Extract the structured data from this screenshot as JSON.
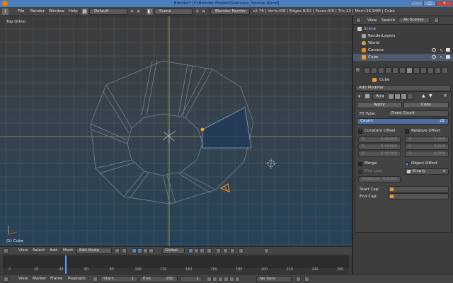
{
  "window": {
    "title": "Blender* [F:\\Blender Models\\Staircase_Tutorial.blend]"
  },
  "info_header": {
    "menus": [
      "File",
      "Render",
      "Window",
      "Help"
    ],
    "layout": "Default",
    "scene": "Scene",
    "engine": "Blender Render",
    "stats": "v2.76 | Verts:0/8 | Edges:0/12 | Faces:0/6 | Tris:12 | Mem:26.94M | Cube"
  },
  "viewport": {
    "view_label": "Top Ortho",
    "object_label": "(1) Cube"
  },
  "view3d_header": {
    "menus": [
      "View",
      "Select",
      "Add",
      "Mesh"
    ],
    "mode": "Edit Mode",
    "orientation": "Global"
  },
  "timeline": {
    "ticks": [
      "0",
      "20",
      "40",
      "60",
      "80",
      "100",
      "120",
      "140",
      "160",
      "180",
      "200",
      "220",
      "240",
      "260"
    ],
    "current_frame_fraction": 0.18
  },
  "timeline_header": {
    "menus": [
      "View",
      "Marker",
      "Frame",
      "Playback"
    ],
    "start_label": "Start:",
    "start": "1",
    "end_label": "End:",
    "end": "250",
    "current": "1",
    "sync": "No Sync"
  },
  "outliner": {
    "menus": [
      "View",
      "Search"
    ],
    "filter": "All Scenes",
    "items": [
      {
        "label": "Scene",
        "icon_color": "#c8c8c8"
      },
      {
        "label": "RenderLayers",
        "icon_color": "#a0a0a0"
      },
      {
        "label": "World",
        "icon_color": "#d9a040"
      },
      {
        "label": "Camera",
        "icon_color": "#d88a2a"
      },
      {
        "label": "Cube",
        "icon_color": "#e89a3a"
      }
    ]
  },
  "properties": {
    "object_name": "Cube",
    "add_modifier": "Add Modifier",
    "modifier_name": "Arra",
    "apply": "Apply",
    "copy": "Copy",
    "fit_type_label": "Fit Type:",
    "fit_type": "Fixed Count",
    "count_label": "Count:",
    "count": "22",
    "constant_offset": "Constant Offset",
    "relative_offset": "Relative Offset",
    "axes": [
      "X:",
      "Y:",
      "Z:"
    ],
    "const_values": [
      "0.00000",
      "0.00000",
      "0.00000"
    ],
    "rel_values": [
      "1.000",
      "0.000",
      "0.000"
    ],
    "merge": "Merge",
    "object_offset": "Object Offset",
    "first_last": "First Last",
    "empty": "Empty",
    "distance_label": "Distance:",
    "distance": "0.0100",
    "start_cap": "Start Cap:",
    "end_cap": "End Cap:"
  },
  "colors": {
    "accent_blue": "#5680c2",
    "title_bar": "#4a7fbf",
    "selected_face": "#1e3a5a"
  }
}
